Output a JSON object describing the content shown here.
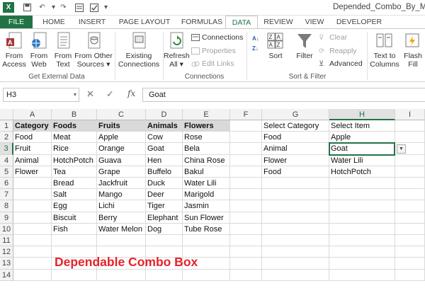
{
  "window": {
    "title": "Depended_Combo_By_M"
  },
  "tabs": [
    "FILE",
    "HOME",
    "INSERT",
    "PAGE LAYOUT",
    "FORMULAS",
    "DATA",
    "REVIEW",
    "VIEW",
    "DEVELOPER"
  ],
  "ribbon": {
    "get_external": {
      "from_access": [
        "From",
        "Access"
      ],
      "from_web": [
        "From",
        "Web"
      ],
      "from_text": [
        "From",
        "Text"
      ],
      "from_other": [
        "From Other",
        "Sources"
      ],
      "label": "Get External Data"
    },
    "existing": [
      "Existing",
      "Connections"
    ],
    "connections": {
      "refresh": [
        "Refresh",
        "All"
      ],
      "connections": "Connections",
      "properties": "Properties",
      "edit_links": "Edit Links",
      "label": "Connections"
    },
    "sort_filter": {
      "sort": "Sort",
      "filter": "Filter",
      "clear": "Clear",
      "reapply": "Reapply",
      "advanced": "Advanced",
      "label": "Sort & Filter"
    },
    "text_to_columns": [
      "Text to",
      "Columns"
    ],
    "flash_fill": [
      "Flash",
      "Fill"
    ]
  },
  "formula_bar": {
    "name_box": "H3",
    "content": "Goat"
  },
  "columns": [
    "A",
    "B",
    "C",
    "D",
    "E",
    "F",
    "G",
    "H",
    "I"
  ],
  "rows": [
    "1",
    "2",
    "3",
    "4",
    "5",
    "6",
    "7",
    "8",
    "9",
    "10",
    "11",
    "12",
    "13",
    "14"
  ],
  "cells": {
    "A1": "Category",
    "B1": "Foods",
    "C1": "Fruits",
    "D1": "Animals",
    "E1": "Flowers",
    "A2": "Food",
    "B2": "Meat",
    "C2": "Apple",
    "D2": "Cow",
    "E2": "Rose",
    "A3": "Fruit",
    "B3": "Rice",
    "C3": "Orange",
    "D3": "Goat",
    "E3": "Bela",
    "A4": "Animal",
    "B4": "HotchPotch",
    "C4": "Guava",
    "D4": "Hen",
    "E4": "China Rose",
    "A5": "Flower",
    "B5": "Tea",
    "C5": "Grape",
    "D5": "Buffelo",
    "E5": "Bakul",
    "B6": "Bread",
    "C6": "Jackfruit",
    "D6": "Duck",
    "E6": "Water Lili",
    "B7": "Salt",
    "C7": "Mango",
    "D7": "Deer",
    "E7": "Marigold",
    "B8": "Egg",
    "C8": "Lichi",
    "D8": "Tiger",
    "E8": "Jasmin",
    "B9": "Biscuit",
    "C9": "Berry",
    "D9": "Elephant",
    "E9": "Sun Flower",
    "B10": "Fish",
    "C10": "Water Melon",
    "D10": "Dog",
    "E10": "Tube Rose",
    "G1": "Select Category",
    "H1": "Select Item",
    "G2": "Food",
    "H2": "Apple",
    "G3": "Animal",
    "H3": "Goat",
    "G4": "Flower",
    "H4": "Water Lili",
    "G5": "Food",
    "H5": "HotchPotch"
  },
  "overlay_title": "Dependable Combo Box",
  "selected_cell": "H3",
  "colors": {
    "accent": "#217346",
    "header_fill": "#d9d9d9",
    "title_red": "#e8222b"
  }
}
